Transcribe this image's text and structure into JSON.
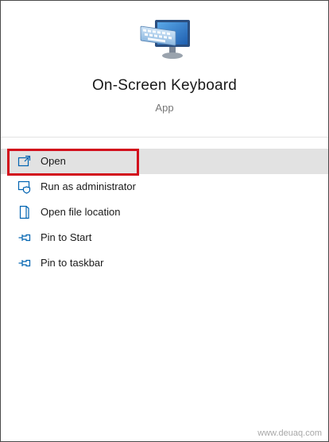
{
  "app": {
    "title": "On-Screen Keyboard",
    "subtitle": "App",
    "icon": "on-screen-keyboard-icon"
  },
  "menu": {
    "items": [
      {
        "label": "Open",
        "icon": "open-icon",
        "selected": true
      },
      {
        "label": "Run as administrator",
        "icon": "shield-icon"
      },
      {
        "label": "Open file location",
        "icon": "file-icon"
      },
      {
        "label": "Pin to Start",
        "icon": "pin-icon"
      },
      {
        "label": "Pin to taskbar",
        "icon": "pin-icon"
      }
    ]
  },
  "annotation": {
    "color": "#d20e1c"
  },
  "colors": {
    "accent": "#0063b1",
    "selected_bg": "#e2e2e2"
  },
  "watermark": "www.deuaq.com"
}
